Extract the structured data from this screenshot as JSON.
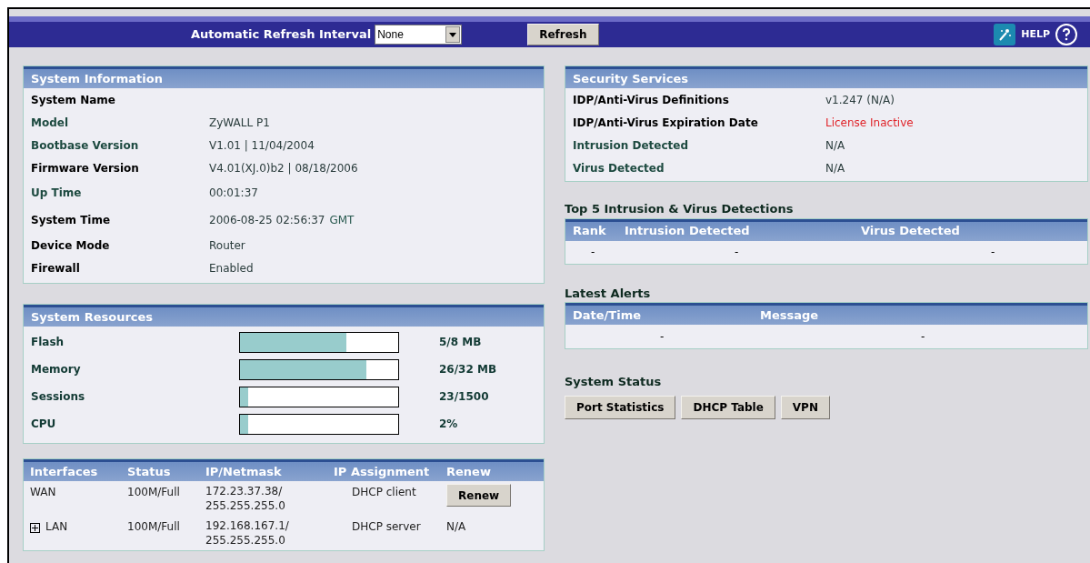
{
  "toolbar": {
    "refresh_label": "Automatic Refresh Interval",
    "refresh_interval": "None",
    "refresh_button": "Refresh",
    "help": "HELP"
  },
  "system_information": {
    "title": "System Information",
    "rows": [
      {
        "label": "System Name",
        "color": "#000000"
      },
      {
        "label": "Model",
        "value": "ZyWALL P1",
        "color": "#1d4a40"
      },
      {
        "label": "Bootbase Version",
        "value": "V1.01 | 11/04/2004",
        "color": "#1d4a40"
      },
      {
        "label": "Firmware Version",
        "value": "V4.01(XJ.0)b2 | 08/18/2006",
        "color": "#000000"
      },
      {
        "label": "Up Time",
        "value": "00:01:37",
        "color": "#1d4a40"
      },
      {
        "label": "System Time",
        "value": "2006-08-25 02:56:37",
        "suffix": "GMT",
        "color": "#000000"
      },
      {
        "label": "Device Mode",
        "value": "Router",
        "color": "#000000"
      },
      {
        "label": "Firewall",
        "value": "Enabled",
        "color": "#000000"
      }
    ]
  },
  "system_resources": {
    "title": "System Resources",
    "rows": [
      {
        "label": "Flash",
        "level": 0.67,
        "reading": "5/8 MB"
      },
      {
        "label": "Memory",
        "level": 0.8,
        "reading": "26/32 MB"
      },
      {
        "label": "Sessions",
        "level": 0.05,
        "reading": "23/1500"
      },
      {
        "label": "CPU",
        "level": 0.05,
        "reading": "2%"
      }
    ]
  },
  "interfaces": {
    "columns": [
      "Interfaces",
      "Status",
      "IP/Netmask",
      "IP Assignment",
      "Renew"
    ],
    "rows": [
      {
        "name": "WAN",
        "expandable": false,
        "status": "100M/Full",
        "ip": "172.23.37.38/",
        "netmask": "255.255.255.0",
        "assignment": "DHCP client",
        "renew": {
          "kind": "button",
          "text": "Renew"
        }
      },
      {
        "name": "LAN",
        "expandable": true,
        "status": "100M/Full",
        "ip": "192.168.167.1/",
        "netmask": "255.255.255.0",
        "assignment": "DHCP server",
        "renew": {
          "kind": "text",
          "text": "N/A"
        }
      }
    ]
  },
  "security_services": {
    "title": "Security Services",
    "rows": [
      {
        "label": "IDP/Anti-Virus Definitions",
        "value": "v1.247 (N/A)",
        "alert": false,
        "color": "#000000"
      },
      {
        "label": "IDP/Anti-Virus Expiration Date",
        "value": "License Inactive",
        "alert": true,
        "color": "#000000"
      },
      {
        "label": "Intrusion Detected",
        "value": "N/A",
        "alert": false,
        "color": "#1d4a40"
      },
      {
        "label": "Virus Detected",
        "value": "N/A",
        "alert": false,
        "color": "#1d4a40"
      }
    ]
  },
  "top5": {
    "title": "Top 5 Intrusion & Virus Detections",
    "columns": [
      "Rank",
      "Intrusion Detected",
      "Virus Detected"
    ],
    "rows": [
      [
        "-",
        "-",
        "-"
      ]
    ]
  },
  "latest_alerts": {
    "title": "Latest Alerts",
    "columns": [
      "Date/Time",
      "Message"
    ],
    "rows": [
      [
        "-",
        "-"
      ]
    ]
  },
  "system_status": {
    "title": "System Status",
    "buttons": [
      "Port Statistics",
      "DHCP Table",
      "VPN"
    ]
  }
}
